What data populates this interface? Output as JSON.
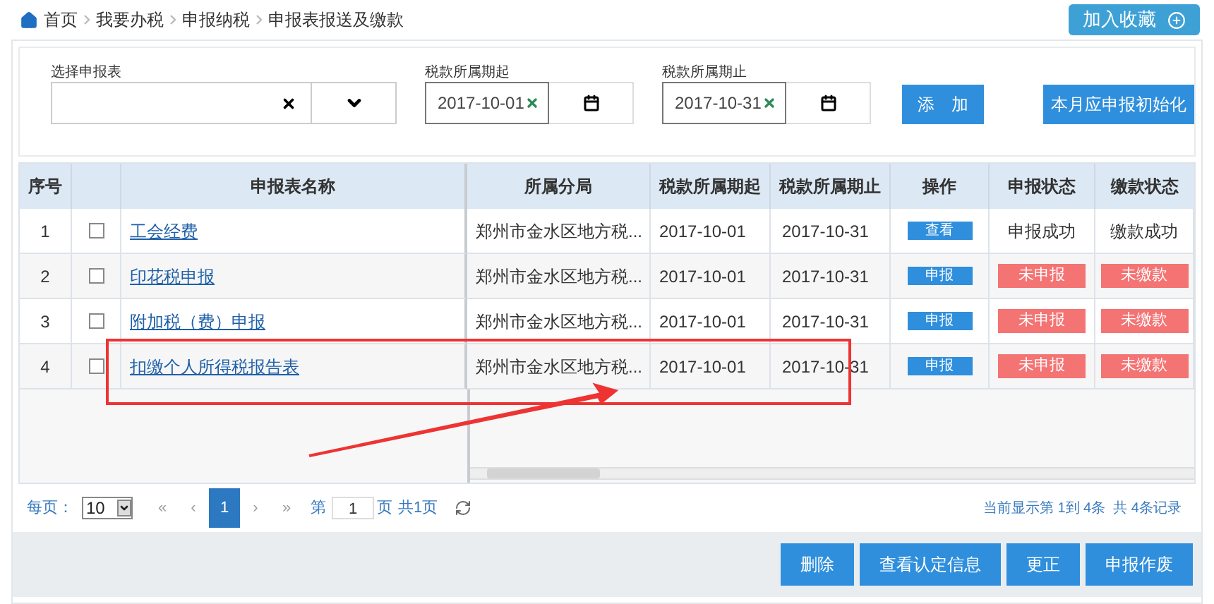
{
  "breadcrumb": [
    {
      "label": "首页"
    },
    {
      "label": "我要办税"
    },
    {
      "label": "申报纳税"
    },
    {
      "label": "申报表报送及缴款"
    }
  ],
  "favorite_button": "加入收藏",
  "form": {
    "report_label": "选择申报表",
    "start_label": "税款所属期起",
    "start_value": "2017-10-01",
    "end_label": "税款所属期止",
    "end_value": "2017-10-31",
    "add_button": "添　加",
    "init_button": "本月应申报初始化"
  },
  "table": {
    "columns": [
      "序号",
      "申报表名称",
      "所属分局",
      "税款所属期起",
      "税款所属期止",
      "操作",
      "申报状态",
      "缴款状态"
    ],
    "rows": [
      {
        "no": "1",
        "checked": false,
        "name": "工会经费",
        "office": "郑州市金水区地方税...",
        "start": "2017-10-01",
        "end": "2017-10-31",
        "action": "查看",
        "declare": {
          "kind": "text",
          "text": "申报成功"
        },
        "pay": {
          "kind": "text",
          "text": "缴款成功"
        }
      },
      {
        "no": "2",
        "checked": false,
        "name": "印花税申报",
        "office": "郑州市金水区地方税...",
        "start": "2017-10-01",
        "end": "2017-10-31",
        "action": "申报",
        "declare": {
          "kind": "badge",
          "text": "未申报"
        },
        "pay": {
          "kind": "badge",
          "text": "未缴款"
        }
      },
      {
        "no": "3",
        "checked": false,
        "name": "附加税（费）申报",
        "office": "郑州市金水区地方税...",
        "start": "2017-10-01",
        "end": "2017-10-31",
        "action": "申报",
        "declare": {
          "kind": "badge",
          "text": "未申报"
        },
        "pay": {
          "kind": "badge",
          "text": "未缴款"
        }
      },
      {
        "no": "4",
        "checked": false,
        "name": "扣缴个人所得税报告表",
        "office": "郑州市金水区地方税...",
        "start": "2017-10-01",
        "end": "2017-10-31",
        "action": "申报",
        "declare": {
          "kind": "badge",
          "text": "未申报"
        },
        "pay": {
          "kind": "badge",
          "text": "未缴款"
        }
      }
    ]
  },
  "pager": {
    "per_page_label": "每页：",
    "per_page": "10",
    "first": "«",
    "prev": "‹",
    "pages": [
      {
        "label": "1",
        "selected": true
      }
    ],
    "next": "›",
    "last": "»",
    "page_prefix": "第",
    "page_value": "1",
    "page_suffix": "页",
    "total_pages": "共1页",
    "summary": "当前显示第 1到 4条  共 4条记录"
  },
  "actions": [
    "删除",
    "查看认定信息",
    "更正",
    "申报作废"
  ]
}
